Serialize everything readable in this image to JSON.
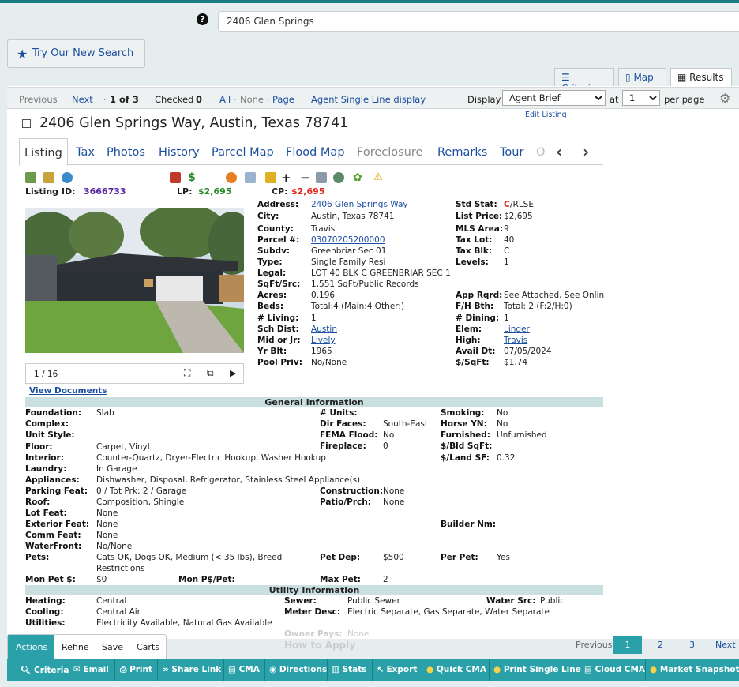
{
  "search": {
    "help": "?",
    "value": "2406 Glen Springs"
  },
  "try_button": "Try Our New Search",
  "view_tabs": {
    "criteria": "Criteria",
    "map": "Map",
    "results": "Results"
  },
  "pager": {
    "previous": "Previous",
    "next": "Next",
    "position": "1 of 3",
    "checked_label": "Checked",
    "checked_count": "0",
    "all": "All",
    "none": "None",
    "page": "Page",
    "agent_single": "Agent Single Line display",
    "display_label": "Display",
    "display_value": "Agent Brief",
    "at_label": "at",
    "per_page_value": "1",
    "per_page_label": "per page",
    "edit_listing": "Edit Listing"
  },
  "listing": {
    "title": "2406 Glen Springs Way, Austin, Texas 78741",
    "tabs": [
      "Listing",
      "Tax",
      "Photos",
      "History",
      "Parcel Map",
      "Flood Map",
      "Foreclosure",
      "Remarks",
      "Tour",
      "O"
    ],
    "listing_id_label": "Listing ID:",
    "listing_id": "3666733",
    "lp_label": "LP:",
    "lp": "$2,695",
    "cp_label": "CP:",
    "cp": "$2,695",
    "photo_counter": "1 / 16",
    "view_documents": "View Documents",
    "colors": {
      "accent": "#2aa1a8",
      "link": "#1b4fa0",
      "price_green": "#2a8a2a",
      "price_red": "#e0261c",
      "id_purple": "#5a2aa0"
    }
  },
  "details_left": [
    {
      "label": "Address:",
      "value": "2406 Glen Springs Way",
      "link": true
    },
    {
      "label": "City:",
      "value": "Austin, Texas 78741"
    },
    {
      "label": "County:",
      "value": "Travis"
    },
    {
      "label": "Parcel #:",
      "value": "03070205200000",
      "link": true
    },
    {
      "label": "Subdv:",
      "value": "Greenbriar Sec 01"
    },
    {
      "label": "Type:",
      "value": "Single Family Resi"
    },
    {
      "label": "Legal:",
      "value": "LOT 40 BLK C GREENBRIAR SEC 1"
    },
    {
      "label": "SqFt/Src:",
      "value": "1,551 SqFt/Public Records"
    },
    {
      "label": "Acres:",
      "value": "0.196"
    },
    {
      "label": "Beds:",
      "value": "Total:4 (Main:4 Other:)"
    },
    {
      "label": "# Living:",
      "value": "1"
    },
    {
      "label": "Sch Dist:",
      "value": "Austin",
      "link": true
    },
    {
      "label": "Mid or Jr:",
      "value": "Lively",
      "link": true
    },
    {
      "label": "Yr Blt:",
      "value": "1965"
    },
    {
      "label": "Pool Priv:",
      "value": "No/None"
    }
  ],
  "details_right": [
    {
      "label": "Std Stat:",
      "value_red": "C",
      "value": "/RLSE"
    },
    {
      "label": "List Price:",
      "value": "$2,695"
    },
    {
      "label": "MLS Area:",
      "value": "9"
    },
    {
      "label": "Tax Lot:",
      "value": "40"
    },
    {
      "label": "Tax Blk:",
      "value": "C"
    },
    {
      "label": "Levels:",
      "value": "1"
    },
    {
      "label": "App Rqrd:",
      "value": "See Attached, See Onlin"
    },
    {
      "label": "F/H Bth:",
      "value": "Total: 2 (F:2/H:0)"
    },
    {
      "label": "# Dining:",
      "value": "1"
    },
    {
      "label": "Elem:",
      "value": "Linder",
      "link": true
    },
    {
      "label": "High:",
      "value": "Travis",
      "link": true
    },
    {
      "label": "Avail Dt:",
      "value": "07/05/2024"
    },
    {
      "label": "$/SqFt:",
      "value": "$1.74"
    }
  ],
  "general_info": {
    "title": "General Information",
    "col1": [
      {
        "label": "Foundation:",
        "value": "Slab"
      },
      {
        "label": "Complex:",
        "value": ""
      },
      {
        "label": "Unit Style:",
        "value": ""
      },
      {
        "label": "Floor:",
        "value": "Carpet, Vinyl"
      },
      {
        "label": "Interior:",
        "value": "Counter-Quartz, Dryer-Electric Hookup, Washer Hookup"
      },
      {
        "label": "Laundry:",
        "value": "In Garage"
      },
      {
        "label": "Appliances:",
        "value": "Dishwasher, Disposal, Refrigerator, Stainless Steel Appliance(s)"
      },
      {
        "label": "Parking Feat:",
        "value": "0 / Tot Prk: 2 / Garage"
      },
      {
        "label": "Roof:",
        "value": "Composition, Shingle"
      },
      {
        "label": "Lot Feat:",
        "value": "None"
      },
      {
        "label": "Exterior Feat:",
        "value": "None"
      },
      {
        "label": "Comm Feat:",
        "value": "None"
      },
      {
        "label": "WaterFront:",
        "value": "No/None"
      },
      {
        "label": "Pets:",
        "value": "Cats OK, Dogs OK, Medium (< 35 lbs), Breed",
        "value2": "Restrictions"
      },
      {
        "label": "Mon Pet $:",
        "value": "$0"
      }
    ],
    "col2": [
      {
        "label": "# Units:",
        "value": ""
      },
      {
        "label": "Dir Faces:",
        "value": "South-East"
      },
      {
        "label": "FEMA Flood:",
        "value": "No"
      },
      {
        "label": "Fireplace:",
        "value": "0"
      },
      {
        "label": "Construction:",
        "value": "None"
      },
      {
        "label": "Patio/Prch:",
        "value": "None"
      },
      {
        "label": "Pet Dep:",
        "value": "$500"
      },
      {
        "label": "Max Pet:",
        "value": "2"
      },
      {
        "label": "Mon P$/Pet:",
        "value": ""
      }
    ],
    "col3": [
      {
        "label": "Smoking:",
        "value": "No"
      },
      {
        "label": "Horse YN:",
        "value": "No"
      },
      {
        "label": "Furnished:",
        "value": "Unfurnished"
      },
      {
        "label": "$/Bld SqFt:",
        "value": ""
      },
      {
        "label": "$/Land SF:",
        "value": "0.32"
      },
      {
        "label": "Builder Nm:",
        "value": ""
      },
      {
        "label": "Per Pet:",
        "value": "Yes"
      }
    ]
  },
  "utility_info": {
    "title": "Utility Information",
    "rows": [
      {
        "label": "Heating:",
        "value": "Central"
      },
      {
        "label": "Cooling:",
        "value": "Central Air"
      },
      {
        "label": "Utilities:",
        "value": "Electricity Available, Natural Gas Available"
      }
    ],
    "mid": [
      {
        "label": "Sewer:",
        "value": "Public Sewer"
      },
      {
        "label": "Meter Desc:",
        "value": "Electric Separate, Gas Separate, Water Separate"
      }
    ],
    "right": [
      {
        "label": "Water Src:",
        "value": "Public"
      }
    ],
    "faded": {
      "owner_pays": "Owner Pays:",
      "owner_value": "None",
      "how_to_apply": "How to Apply"
    }
  },
  "footer_tabs": [
    "Actions",
    "Refine",
    "Save",
    "Carts"
  ],
  "pages": {
    "previous": "Previous",
    "items": [
      "1",
      "2",
      "3"
    ],
    "next": "Next",
    "current": "1"
  },
  "actions": [
    "Criteria",
    "Email",
    "Print",
    "Share Link",
    "CMA",
    "Directions",
    "Stats",
    "Export",
    "Quick CMA",
    "Print Single Line",
    "Cloud CMA",
    "Market Snapshot"
  ]
}
